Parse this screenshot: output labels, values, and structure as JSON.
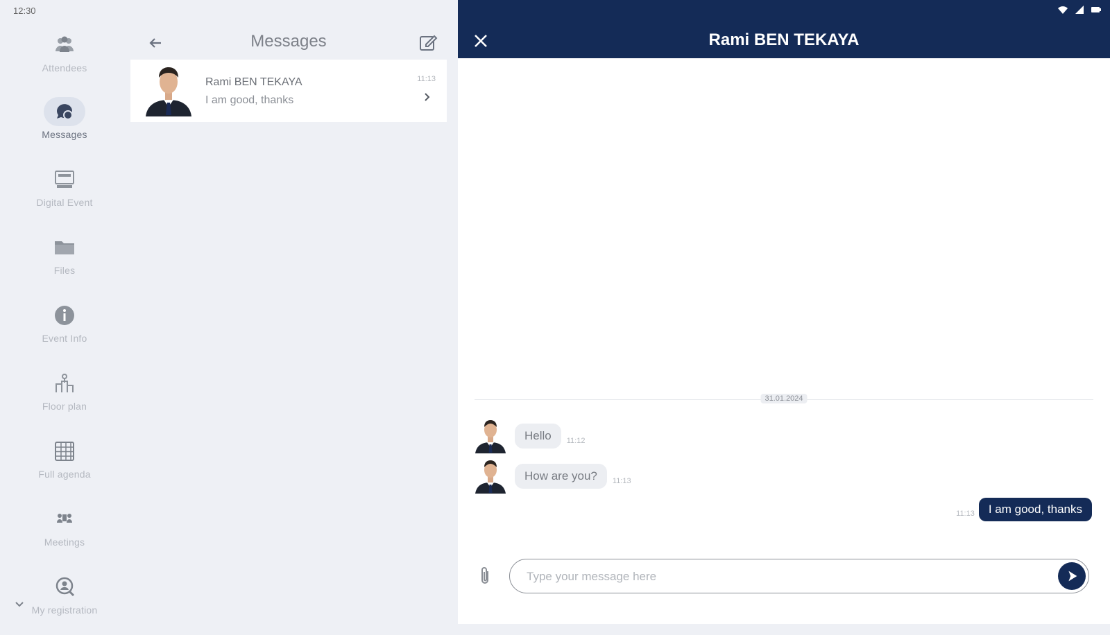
{
  "status_bar": {
    "time": "12:30"
  },
  "nav": {
    "items": [
      {
        "label": "Attendees",
        "icon": "attendees-icon",
        "active": false
      },
      {
        "label": "Messages",
        "icon": "chat-icon",
        "active": true
      },
      {
        "label": "Digital Event",
        "icon": "digital-event-icon",
        "active": false
      },
      {
        "label": "Files",
        "icon": "folder-icon",
        "active": false
      },
      {
        "label": "Event Info",
        "icon": "info-icon",
        "active": false
      },
      {
        "label": "Floor plan",
        "icon": "floor-plan-icon",
        "active": false
      },
      {
        "label": "Full agenda",
        "icon": "calendar-grid-icon",
        "active": false
      },
      {
        "label": "Meetings",
        "icon": "meetings-icon",
        "active": false
      },
      {
        "label": "My registration",
        "icon": "registration-icon",
        "active": false
      }
    ]
  },
  "messages_list": {
    "title": "Messages",
    "conversations": [
      {
        "name": "Rami BEN TEKAYA",
        "preview": "I am good, thanks",
        "time": "11:13"
      }
    ]
  },
  "chat": {
    "title": "Rami BEN TEKAYA",
    "date_separator": "31.01.2024",
    "messages": [
      {
        "text": "Hello",
        "time": "11:12",
        "direction": "in"
      },
      {
        "text": "How are you?",
        "time": "11:13",
        "direction": "in"
      },
      {
        "text": "I am good, thanks",
        "time": "11:13",
        "direction": "out"
      }
    ],
    "input_placeholder": "Type your message here"
  },
  "colors": {
    "primary": "#142b57",
    "background": "#eef0f5",
    "bubble_in": "#eceef2"
  }
}
